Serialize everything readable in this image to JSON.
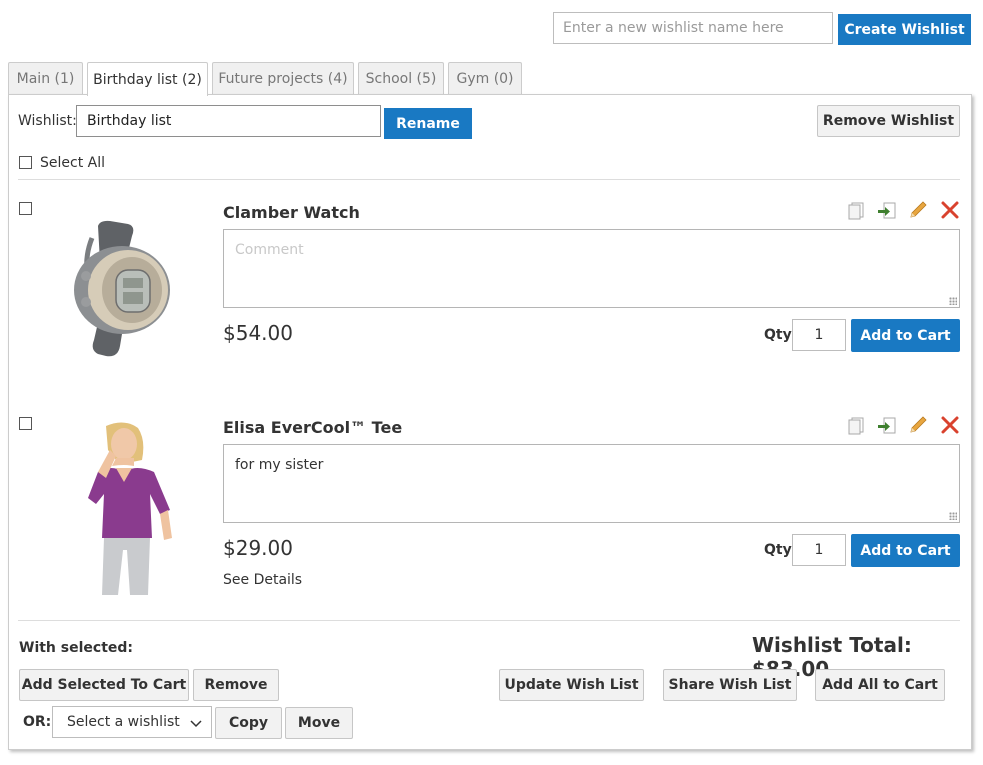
{
  "create": {
    "placeholder": "Enter a new wishlist name here",
    "button_label": "Create Wishlist"
  },
  "tabs": [
    {
      "label": "Main (1)"
    },
    {
      "label": "Birthday list (2)"
    },
    {
      "label": "Future projects (4)"
    },
    {
      "label": "School (5)"
    },
    {
      "label": "Gym (0)"
    }
  ],
  "active_tab": "Birthday list (2)",
  "wishlist": {
    "label": "Wishlist:",
    "name_value": "Birthday list",
    "rename_label": "Rename",
    "remove_label": "Remove Wishlist",
    "select_all_label": "Select All"
  },
  "items": [
    {
      "name": "Clamber Watch",
      "comment_placeholder": "Comment",
      "comment_value": "",
      "price": "$54.00",
      "qty_label": "Qty",
      "qty": "1",
      "add_to_cart_label": "Add to Cart"
    },
    {
      "name": "Elisa EverCool™ Tee",
      "comment_placeholder": "Comment",
      "comment_value": "for my sister",
      "price": "$29.00",
      "details_label": "See Details",
      "qty_label": "Qty",
      "qty": "1",
      "add_to_cart_label": "Add to Cart"
    }
  ],
  "item_icons": [
    "copy-icon",
    "move-icon",
    "edit-pencil-icon",
    "delete-x-icon"
  ],
  "footer": {
    "with_selected_label": "With selected:",
    "total_label": "Wishlist Total: $83.00",
    "add_selected_label": "Add Selected To Cart",
    "remove_label": "Remove",
    "update_label": "Update Wish List",
    "share_label": "Share Wish List",
    "add_all_label": "Add All to Cart",
    "or_label": "OR:",
    "select_value": "Select a wishlist",
    "copy_label": "Copy",
    "move_label": "Move"
  },
  "colors": {
    "primary": "#1979c3",
    "delete": "#d9422e",
    "pencil": "#e8a640",
    "move_arrow": "#3f7f2f"
  }
}
